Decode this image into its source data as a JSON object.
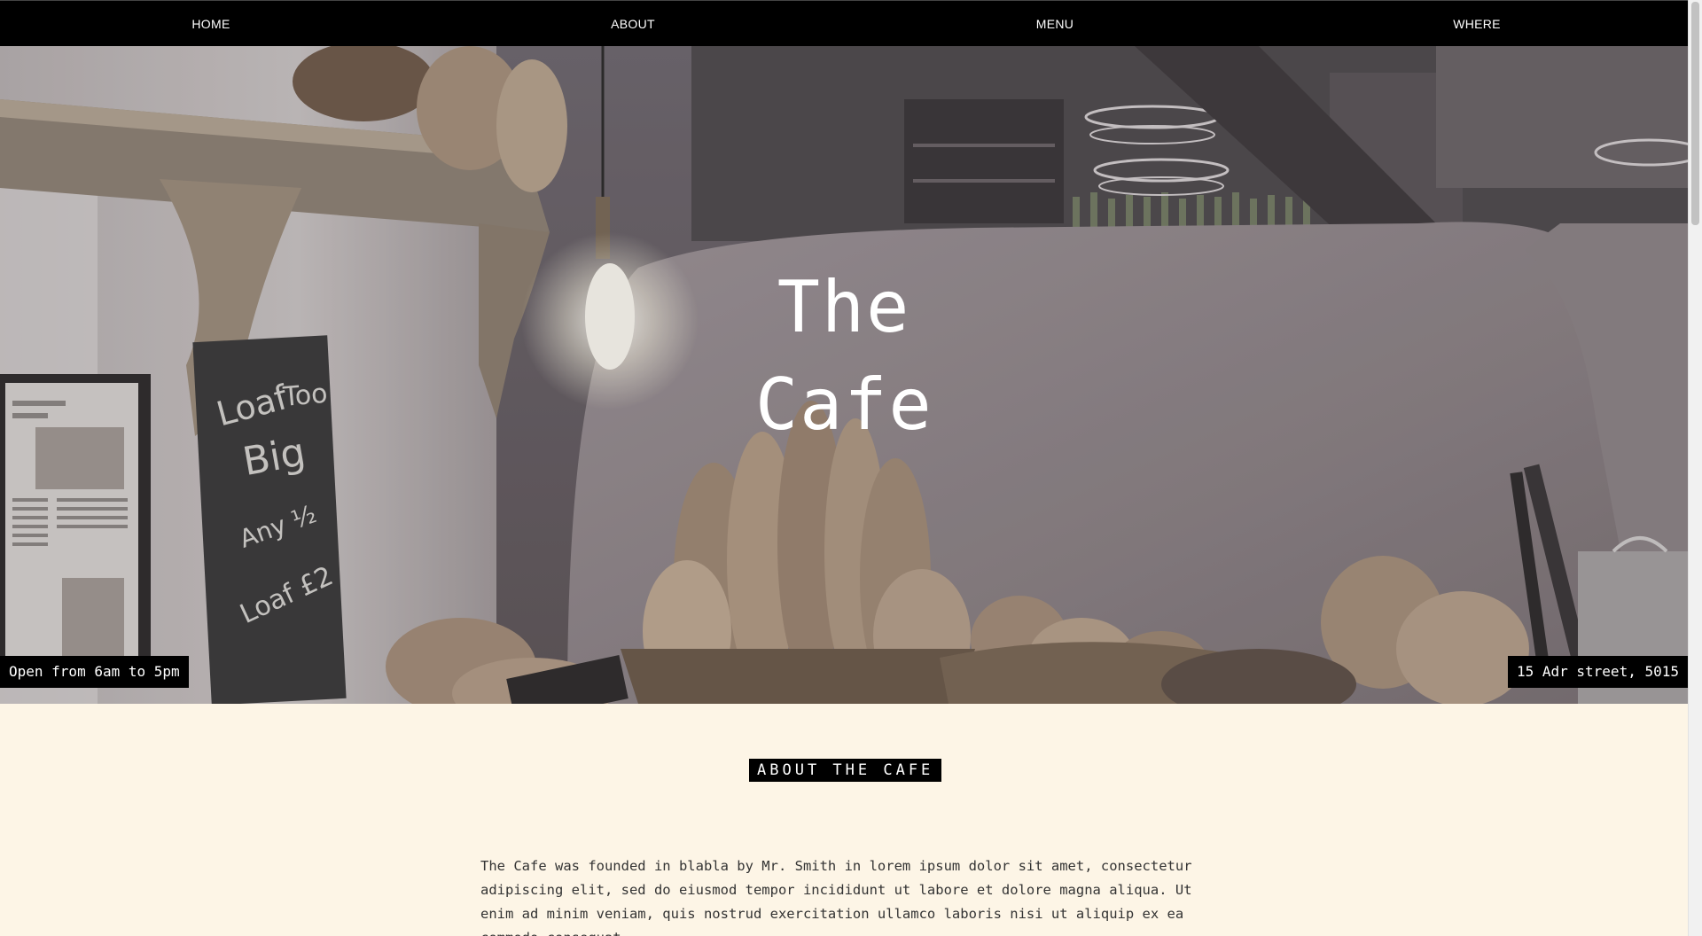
{
  "nav": {
    "items": [
      {
        "label": "HOME"
      },
      {
        "label": "ABOUT"
      },
      {
        "label": "MENU"
      },
      {
        "label": "WHERE"
      }
    ]
  },
  "hero": {
    "title_line1": "The",
    "title_line2": "Cafe",
    "hours": "Open from 6am to 5pm",
    "address": "15 Adr street, 5015",
    "chalkboard_text": "Loaf Too Big ½ Any ½ Loaf £2"
  },
  "about": {
    "heading": "ABOUT THE CAFE",
    "body": "The Cafe was founded in blabla by Mr. Smith in lorem ipsum dolor sit amet, consectetur adipiscing elit, sed do eiusmod tempor incididunt ut labore et dolore magna aliqua. Ut enim ad minim veniam, quis nostrud exercitation ullamco laboris nisi ut aliquip ex ea commodo consequat."
  }
}
